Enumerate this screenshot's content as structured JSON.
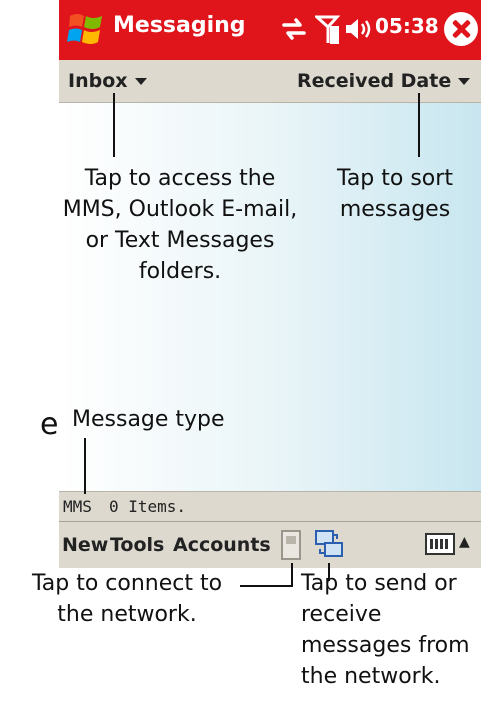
{
  "titlebar": {
    "app_title": "Messaging",
    "time": "05:38",
    "color": "#e0141b",
    "icons": [
      "windows-start-icon",
      "connectivity-icon",
      "signal-icon",
      "volume-icon",
      "close-icon"
    ]
  },
  "toolbar": {
    "folder_label": "Inbox",
    "sort_label": "Received Date"
  },
  "statusline": {
    "message_type": "MMS",
    "item_count": "0 Items."
  },
  "menubar": {
    "new_label": "New",
    "tools_label": "Tools",
    "accounts_label": "Accounts"
  },
  "callouts": {
    "folder_line1": "Tap to access the",
    "folder_line2": "MMS, Outlook E-mail,",
    "folder_line3": "or Text Messages",
    "folder_line4": "folders.",
    "sort_line1": "Tap to sort",
    "sort_line2": "messages",
    "type": "Message type",
    "edge_fragment": "e",
    "connect_line1": "Tap to connect to",
    "connect_line2": "the network.",
    "send_line1": "Tap to send or",
    "send_line2": "receive",
    "send_line3": "messages from",
    "send_line4": "the network."
  }
}
